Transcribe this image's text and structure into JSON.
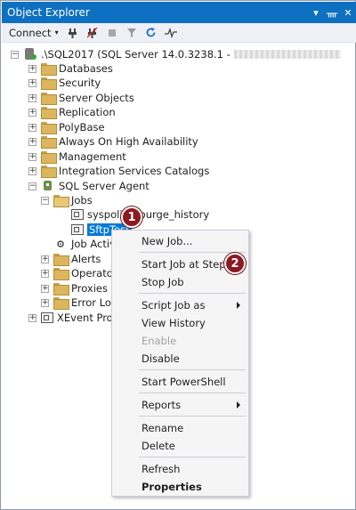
{
  "panel": {
    "title": "Object Explorer",
    "buttons": {
      "dropdown": "▾",
      "pin": "ᚄ",
      "close": "✕"
    }
  },
  "toolbar": {
    "connect_label": "Connect",
    "connect_caret": "▾"
  },
  "tree": {
    "server_label": ".\\SQL2017 (SQL Server 14.0.3238.1 -",
    "items": {
      "databases": "Databases",
      "security": "Security",
      "server_objects": "Server Objects",
      "replication": "Replication",
      "polybase": "PolyBase",
      "always_on": "Always On High Availability",
      "management": "Management",
      "integration_services": "Integration Services Catalogs",
      "sql_server_agent": "SQL Server Agent",
      "jobs": "Jobs",
      "job_syspolicy": "syspolicy_purge_history",
      "job_sftptest": "SftpTest",
      "job_activity": "Job Activity Monitor",
      "alerts": "Alerts",
      "operators": "Operators",
      "proxies": "Proxies",
      "error_logs": "Error Logs",
      "xevent_profiler": "XEvent Profiler"
    }
  },
  "context_menu": {
    "new_job": "New Job...",
    "start_job_at_step": "Start Job at Step...",
    "stop_job": "Stop Job",
    "script_job_as": "Script Job as",
    "view_history": "View History",
    "enable": "Enable",
    "disable": "Disable",
    "start_powershell": "Start PowerShell",
    "reports": "Reports",
    "rename": "Rename",
    "delete": "Delete",
    "refresh": "Refresh",
    "properties": "Properties"
  },
  "callouts": {
    "one": "1",
    "two": "2"
  },
  "colors": {
    "title_bar": "#0e70c0",
    "selection": "#0078d7",
    "callout": "#8b1a22"
  },
  "icons": [
    "connect-icon",
    "disconnect-icon",
    "stop-icon",
    "filter-icon",
    "refresh-icon",
    "activity-monitor-icon"
  ]
}
